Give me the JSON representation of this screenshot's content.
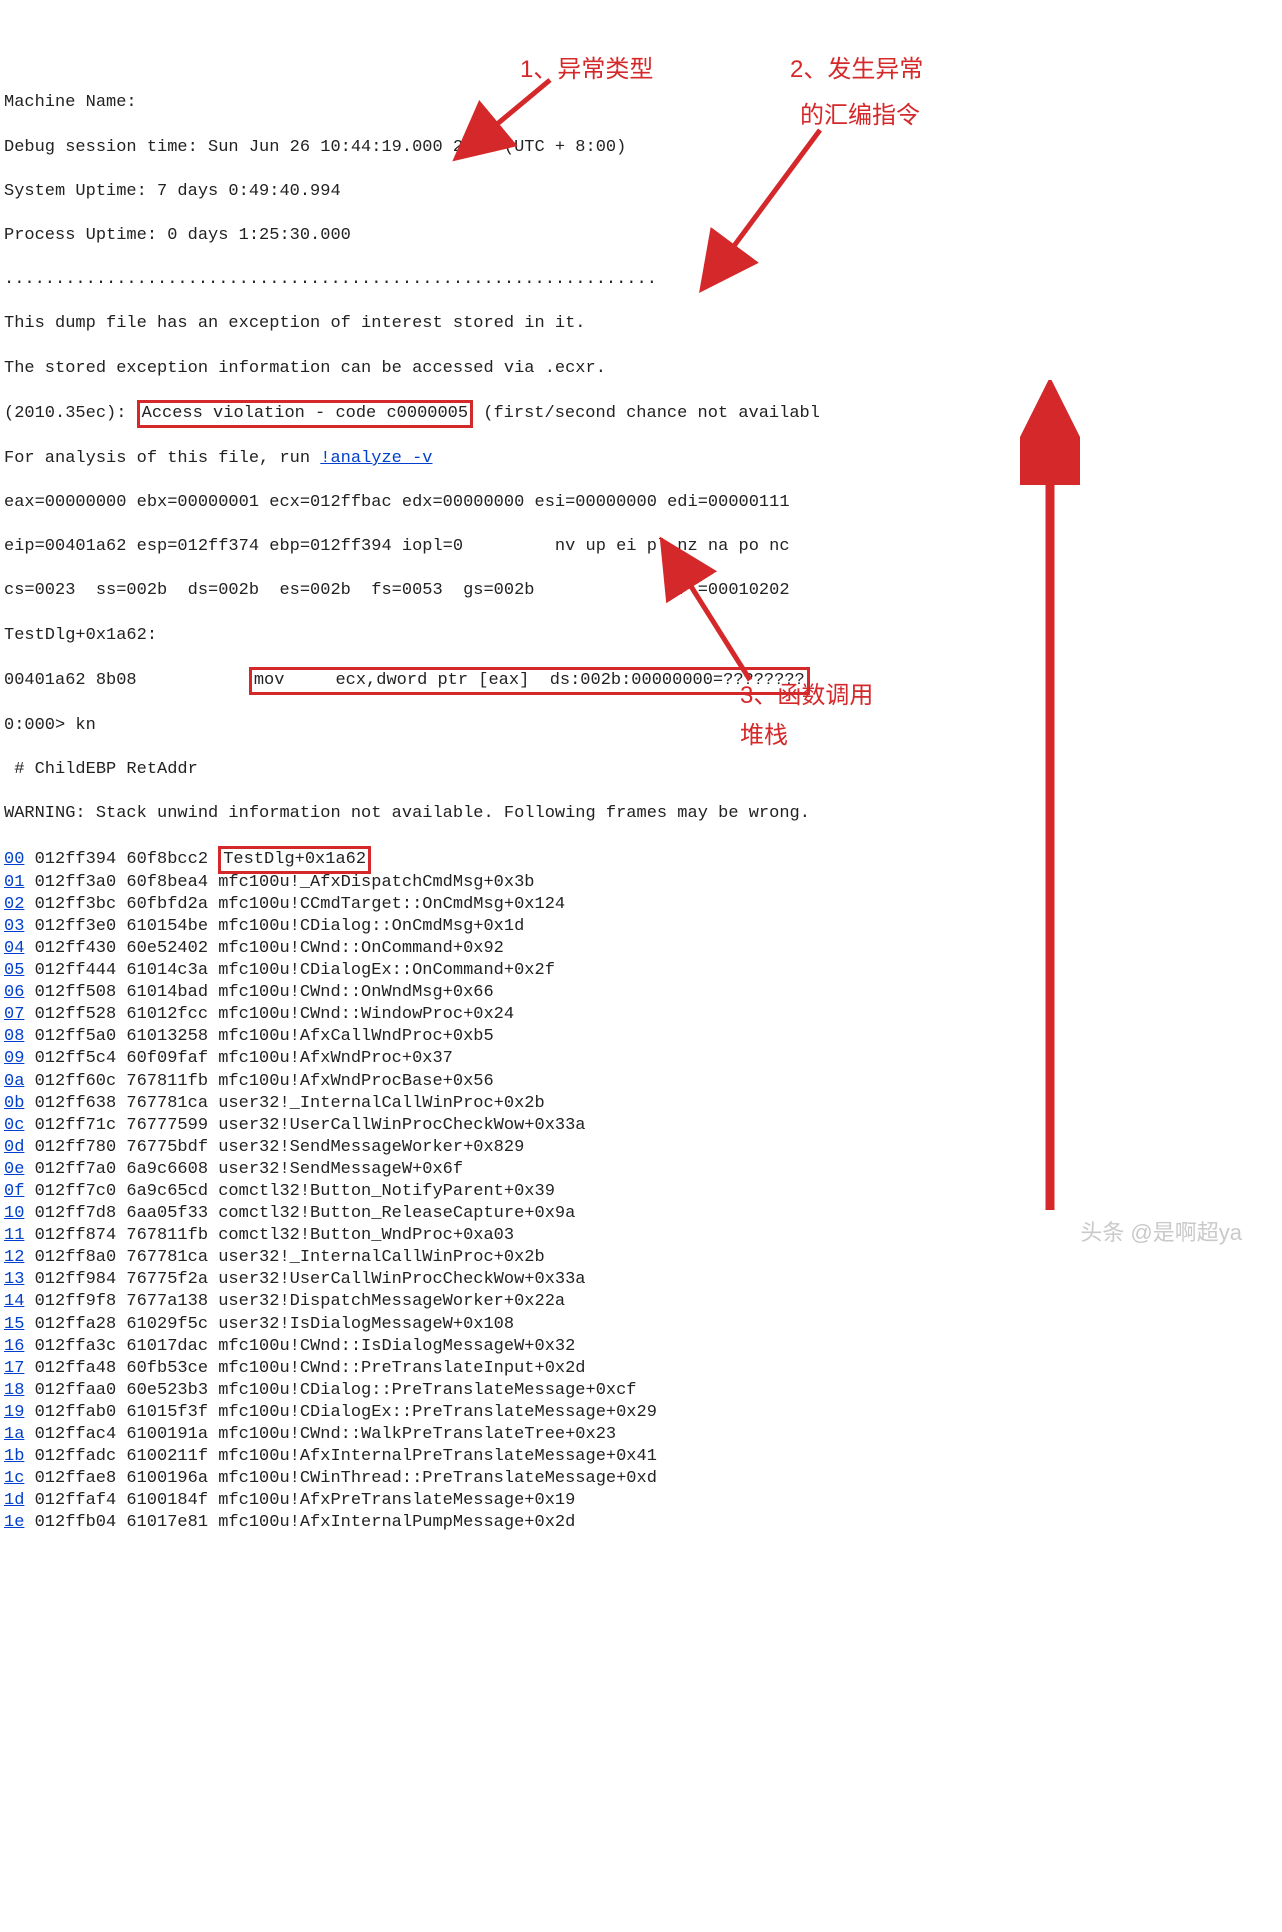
{
  "header": {
    "machine_name": "Machine Name:",
    "debug_time": "Debug session time: Sun Jun 26 10:44:19.000 2022 (UTC + 8:00)",
    "system_uptime": "System Uptime: 7 days 0:49:40.994",
    "process_uptime": "Process Uptime: 0 days 1:25:30.000",
    "dots": "................................................................",
    "dump_line": "This dump file has an exception of interest stored in it.",
    "stored_line": "The stored exception information can be accessed via .ecxr.",
    "prefix_code": "(2010.35ec): ",
    "violation": "Access violation - code c0000005",
    "chance": " (first/second chance not availabl",
    "analysis_pre": "For analysis of this file, run ",
    "analysis_link": "!analyze -v"
  },
  "regs": {
    "l1": "eax=00000000 ebx=00000001 ecx=012ffbac edx=00000000 esi=00000000 edi=00000111",
    "l2": "eip=00401a62 esp=012ff374 ebp=012ff394 iopl=0         nv up ei pl nz na po nc",
    "l3": "cs=0023  ss=002b  ds=002b  es=002b  fs=0053  gs=002b             efl=00010202"
  },
  "asm": {
    "label": "TestDlg+0x1a62:",
    "addr": "00401a62 8b08           ",
    "instr": "mov     ecx,dword ptr [eax]  ds:002b:00000000=????????"
  },
  "prompt": {
    "kn": "0:000> kn",
    "header": " # ChildEBP RetAddr",
    "warning": "WARNING: Stack unwind information not available. Following frames may be wrong."
  },
  "stack": [
    {
      "n": "00",
      "ebp": "012ff394",
      "ret": "60f8bcc2",
      "sym": "TestDlg+0x1a62",
      "boxed": true
    },
    {
      "n": "01",
      "ebp": "012ff3a0",
      "ret": "60f8bea4",
      "sym": "mfc100u!_AfxDispatchCmdMsg+0x3b"
    },
    {
      "n": "02",
      "ebp": "012ff3bc",
      "ret": "60fbfd2a",
      "sym": "mfc100u!CCmdTarget::OnCmdMsg+0x124"
    },
    {
      "n": "03",
      "ebp": "012ff3e0",
      "ret": "610154be",
      "sym": "mfc100u!CDialog::OnCmdMsg+0x1d"
    },
    {
      "n": "04",
      "ebp": "012ff430",
      "ret": "60e52402",
      "sym": "mfc100u!CWnd::OnCommand+0x92"
    },
    {
      "n": "05",
      "ebp": "012ff444",
      "ret": "61014c3a",
      "sym": "mfc100u!CDialogEx::OnCommand+0x2f"
    },
    {
      "n": "06",
      "ebp": "012ff508",
      "ret": "61014bad",
      "sym": "mfc100u!CWnd::OnWndMsg+0x66"
    },
    {
      "n": "07",
      "ebp": "012ff528",
      "ret": "61012fcc",
      "sym": "mfc100u!CWnd::WindowProc+0x24"
    },
    {
      "n": "08",
      "ebp": "012ff5a0",
      "ret": "61013258",
      "sym": "mfc100u!AfxCallWndProc+0xb5"
    },
    {
      "n": "09",
      "ebp": "012ff5c4",
      "ret": "60f09faf",
      "sym": "mfc100u!AfxWndProc+0x37"
    },
    {
      "n": "0a",
      "ebp": "012ff60c",
      "ret": "767811fb",
      "sym": "mfc100u!AfxWndProcBase+0x56"
    },
    {
      "n": "0b",
      "ebp": "012ff638",
      "ret": "767781ca",
      "sym": "user32!_InternalCallWinProc+0x2b"
    },
    {
      "n": "0c",
      "ebp": "012ff71c",
      "ret": "76777599",
      "sym": "user32!UserCallWinProcCheckWow+0x33a"
    },
    {
      "n": "0d",
      "ebp": "012ff780",
      "ret": "76775bdf",
      "sym": "user32!SendMessageWorker+0x829"
    },
    {
      "n": "0e",
      "ebp": "012ff7a0",
      "ret": "6a9c6608",
      "sym": "user32!SendMessageW+0x6f"
    },
    {
      "n": "0f",
      "ebp": "012ff7c0",
      "ret": "6a9c65cd",
      "sym": "comctl32!Button_NotifyParent+0x39"
    },
    {
      "n": "10",
      "ebp": "012ff7d8",
      "ret": "6aa05f33",
      "sym": "comctl32!Button_ReleaseCapture+0x9a"
    },
    {
      "n": "11",
      "ebp": "012ff874",
      "ret": "767811fb",
      "sym": "comctl32!Button_WndProc+0xa03"
    },
    {
      "n": "12",
      "ebp": "012ff8a0",
      "ret": "767781ca",
      "sym": "user32!_InternalCallWinProc+0x2b"
    },
    {
      "n": "13",
      "ebp": "012ff984",
      "ret": "76775f2a",
      "sym": "user32!UserCallWinProcCheckWow+0x33a"
    },
    {
      "n": "14",
      "ebp": "012ff9f8",
      "ret": "7677a138",
      "sym": "user32!DispatchMessageWorker+0x22a"
    },
    {
      "n": "15",
      "ebp": "012ffa28",
      "ret": "61029f5c",
      "sym": "user32!IsDialogMessageW+0x108"
    },
    {
      "n": "16",
      "ebp": "012ffa3c",
      "ret": "61017dac",
      "sym": "mfc100u!CWnd::IsDialogMessageW+0x32"
    },
    {
      "n": "17",
      "ebp": "012ffa48",
      "ret": "60fb53ce",
      "sym": "mfc100u!CWnd::PreTranslateInput+0x2d"
    },
    {
      "n": "18",
      "ebp": "012ffaa0",
      "ret": "60e523b3",
      "sym": "mfc100u!CDialog::PreTranslateMessage+0xcf"
    },
    {
      "n": "19",
      "ebp": "012ffab0",
      "ret": "61015f3f",
      "sym": "mfc100u!CDialogEx::PreTranslateMessage+0x29"
    },
    {
      "n": "1a",
      "ebp": "012ffac4",
      "ret": "6100191a",
      "sym": "mfc100u!CWnd::WalkPreTranslateTree+0x23"
    },
    {
      "n": "1b",
      "ebp": "012ffadc",
      "ret": "6100211f",
      "sym": "mfc100u!AfxInternalPreTranslateMessage+0x41"
    },
    {
      "n": "1c",
      "ebp": "012ffae8",
      "ret": "6100196a",
      "sym": "mfc100u!CWinThread::PreTranslateMessage+0xd"
    },
    {
      "n": "1d",
      "ebp": "012ffaf4",
      "ret": "6100184f",
      "sym": "mfc100u!AfxPreTranslateMessage+0x19"
    },
    {
      "n": "1e",
      "ebp": "012ffb04",
      "ret": "61017e81",
      "sym": "mfc100u!AfxInternalPumpMessage+0x2d"
    }
  ],
  "annotations": {
    "a1": "1、异常类型",
    "a2": "2、发生异常",
    "a2b": "的汇编指令",
    "a3": "3、函数调用",
    "a3b": "堆栈"
  },
  "watermark": "头条 @是啊超ya"
}
